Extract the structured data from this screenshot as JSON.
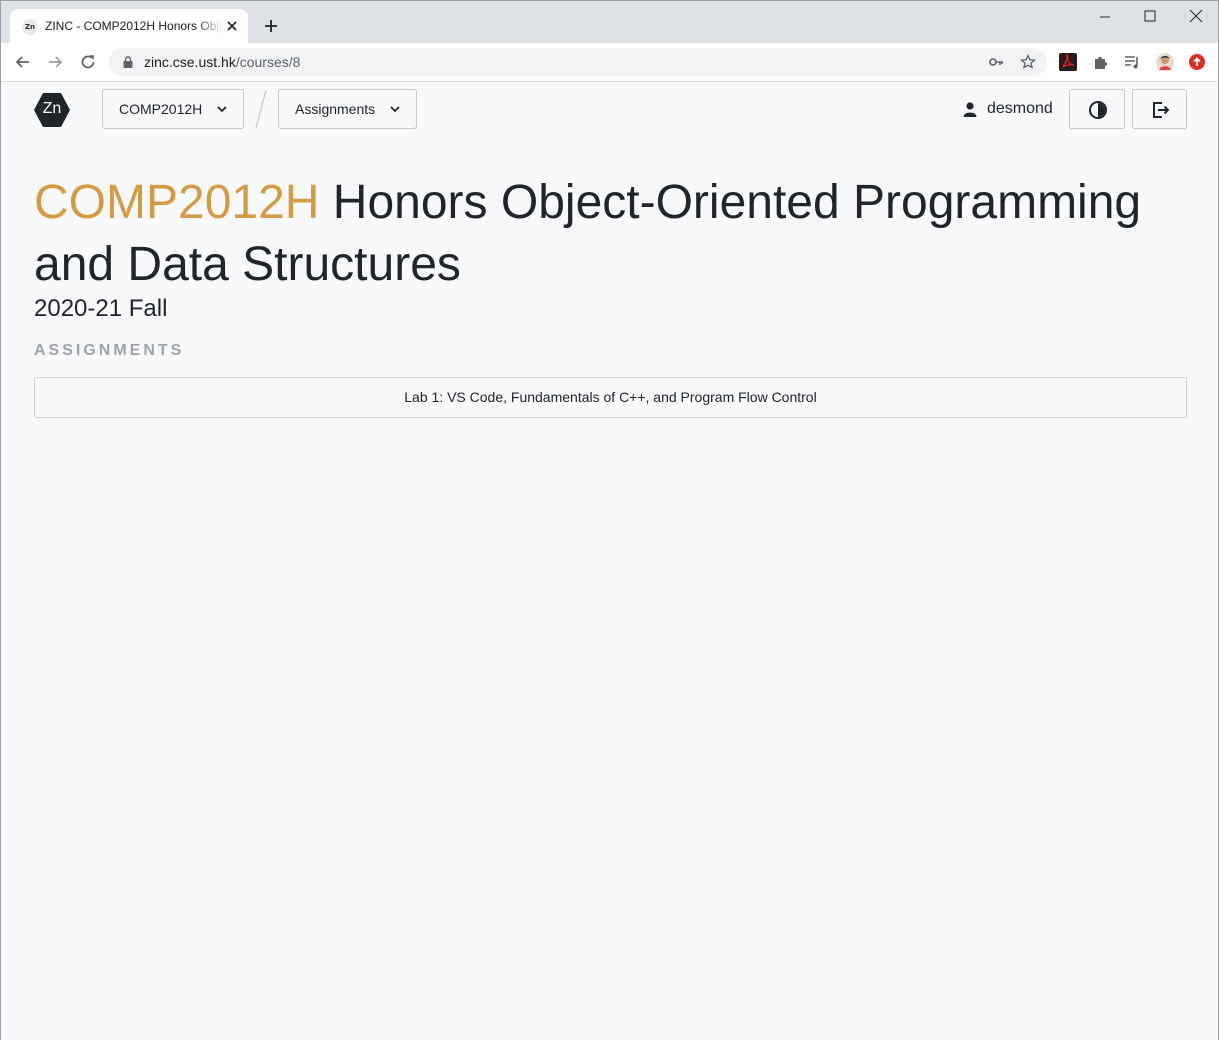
{
  "browser": {
    "tab": {
      "favicon_text": "Zn",
      "title": "ZINC - COMP2012H Honors Object-Oriented Programming and Data Structures"
    },
    "url": {
      "host": "zinc.cse.ust.hk",
      "path": "/courses/8"
    }
  },
  "nav": {
    "logo_text": "Zn",
    "course_dropdown": "COMP2012H",
    "section_dropdown": "Assignments",
    "username": "desmond"
  },
  "course": {
    "code": "COMP2012H",
    "name": "Honors Object-Oriented Programming and Data Structures",
    "semester": "2020-21 Fall"
  },
  "assignments": {
    "heading": "ASSIGNMENTS",
    "items": [
      {
        "title": "Lab 1: VS Code, Fundamentals of C++, and Program Flow Control"
      }
    ]
  },
  "colors": {
    "course_code_accent": "#d29b44",
    "logo_background": "#212529"
  }
}
